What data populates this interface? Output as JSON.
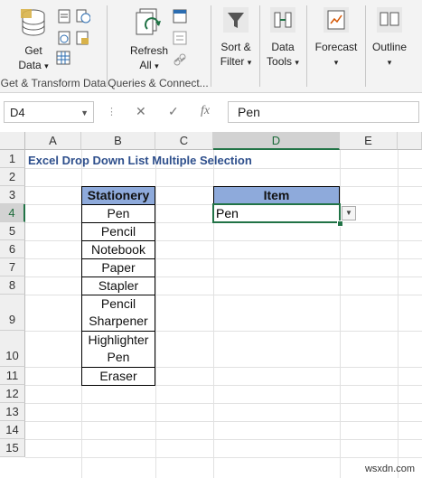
{
  "ribbon": {
    "get_data": {
      "line1": "Get",
      "line2": "Data",
      "caret": "▾"
    },
    "group1_label": "Get & Transform Data",
    "refresh": {
      "line1": "Refresh",
      "line2": "All",
      "caret": "▾"
    },
    "group2_label": "Queries & Connect...",
    "sort_filter": {
      "line1": "Sort &",
      "line2": "Filter",
      "caret": "▾"
    },
    "data_tools": {
      "line1": "Data",
      "line2": "Tools",
      "caret": "▾"
    },
    "forecast": {
      "line1": "Forecast",
      "caret": "▾"
    },
    "outline": {
      "line1": "Outline",
      "caret": "▾"
    }
  },
  "formula_bar": {
    "name_box": "D4",
    "cancel_symbol": "✕",
    "enter_symbol": "✓",
    "fx_symbol": "fx",
    "formula": "Pen"
  },
  "sheet": {
    "columns": [
      "A",
      "B",
      "C",
      "D",
      "E"
    ],
    "rows": [
      "1",
      "2",
      "3",
      "4",
      "5",
      "6",
      "7",
      "8",
      "9",
      "10",
      "11",
      "12",
      "13",
      "14",
      "15"
    ],
    "title": "Excel Drop Down List Multiple Selection",
    "stationery_header": "Stationery",
    "stationery_items": [
      "Pen",
      "Pencil",
      "Notebook",
      "Paper",
      "Stapler",
      "Pencil",
      "Sharpener",
      "Highlighter",
      "Pen",
      "Eraser"
    ],
    "item_header": "Item",
    "item_value": "Pen",
    "dropdown_glyph": "▼"
  },
  "watermark": "wsxdn.com",
  "colors": {
    "header_fill": "#8eaadb",
    "title_color": "#2e4f8c",
    "selection_green": "#217346"
  }
}
